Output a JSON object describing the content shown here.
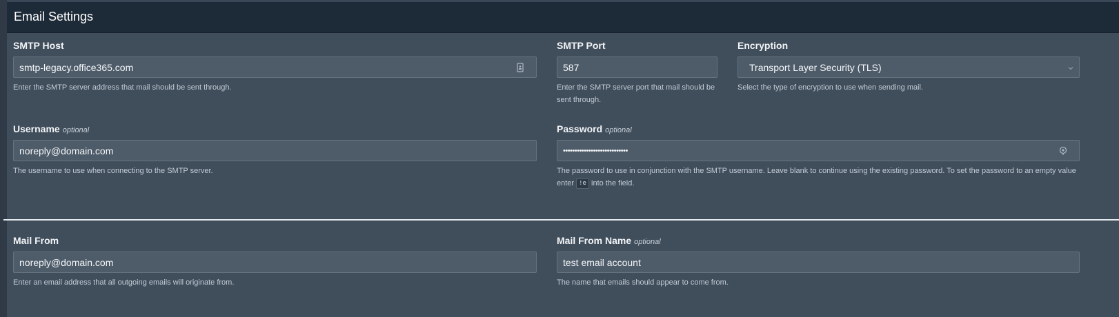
{
  "panel": {
    "title": "Email Settings"
  },
  "smtp_host": {
    "label": "SMTP Host",
    "value": "smtp-legacy.office365.com",
    "help": "Enter the SMTP server address that mail should be sent through."
  },
  "smtp_port": {
    "label": "SMTP Port",
    "value": "587",
    "help": "Enter the SMTP server port that mail should be sent through."
  },
  "encryption": {
    "label": "Encryption",
    "selected": "Transport Layer Security (TLS)",
    "help": "Select the type of encryption to use when sending mail."
  },
  "username": {
    "label": "Username",
    "optional": "optional",
    "value": "noreply@domain.com",
    "help": "The username to use when connecting to the SMTP server."
  },
  "password": {
    "label": "Password",
    "optional": "optional",
    "value": "••••••••••••••••••••••••••••",
    "help_before": "The password to use in conjunction with the SMTP username. Leave blank to continue using the existing password. To set the password to an empty value enter",
    "help_code": "!e",
    "help_after": "into the field."
  },
  "mail_from": {
    "label": "Mail From",
    "value": "noreply@domain.com",
    "help": "Enter an email address that all outgoing emails will originate from."
  },
  "mail_from_name": {
    "label": "Mail From Name",
    "optional": "optional",
    "value": "test email account",
    "help": "The name that emails should appear to come from."
  },
  "icons": {
    "smtp_host": "contact-card-icon",
    "password": "password-reveal-icon",
    "encryption": "chevron-down-icon"
  }
}
